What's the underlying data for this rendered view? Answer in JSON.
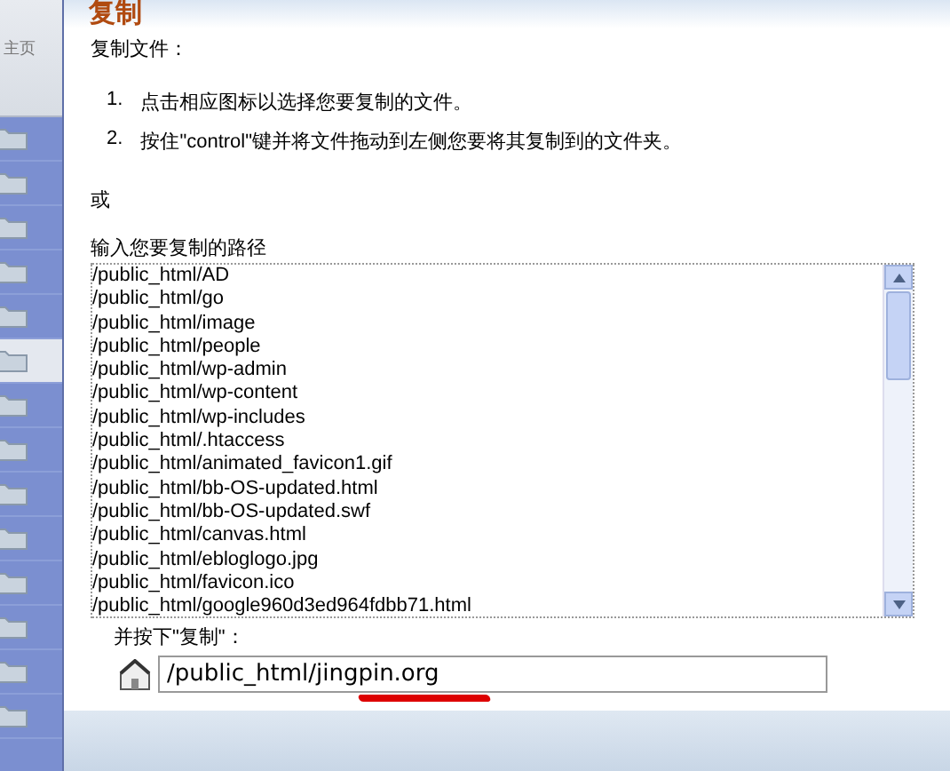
{
  "sidebar": {
    "home_label": "主页",
    "rows": [
      {
        "selected": false
      },
      {
        "selected": false
      },
      {
        "selected": false
      },
      {
        "selected": false
      },
      {
        "selected": false
      },
      {
        "selected": true
      },
      {
        "selected": false
      },
      {
        "selected": false
      },
      {
        "selected": false
      },
      {
        "selected": false
      },
      {
        "selected": false
      },
      {
        "selected": false
      },
      {
        "selected": false
      },
      {
        "selected": false
      }
    ]
  },
  "dialog": {
    "title": "复制",
    "intro": "复制文件：",
    "steps": [
      {
        "number": "1.",
        "text": "点击相应图标以选择您要复制的文件。"
      },
      {
        "number": "2.",
        "text": "按住\"control\"键并将文件拖动到左侧您要将其复制到的文件夹。"
      }
    ],
    "or": "或",
    "path_label": "输入您要复制的路径",
    "paths": [
      "/public_html/AD",
      "/public_html/go",
      "/public_html/image",
      "/public_html/people",
      "/public_html/wp-admin",
      "/public_html/wp-content",
      "/public_html/wp-includes",
      "/public_html/.htaccess",
      "/public_html/animated_favicon1.gif",
      "/public_html/bb-OS-updated.html",
      "/public_html/bb-OS-updated.swf",
      "/public_html/canvas.html",
      "/public_html/ebloglogo.jpg",
      "/public_html/favicon.ico",
      "/public_html/google960d3ed964fdbb71.html"
    ],
    "press_label": "并按下\"复制\"：",
    "destination": {
      "value": "/public_html/jingpin.org"
    }
  }
}
